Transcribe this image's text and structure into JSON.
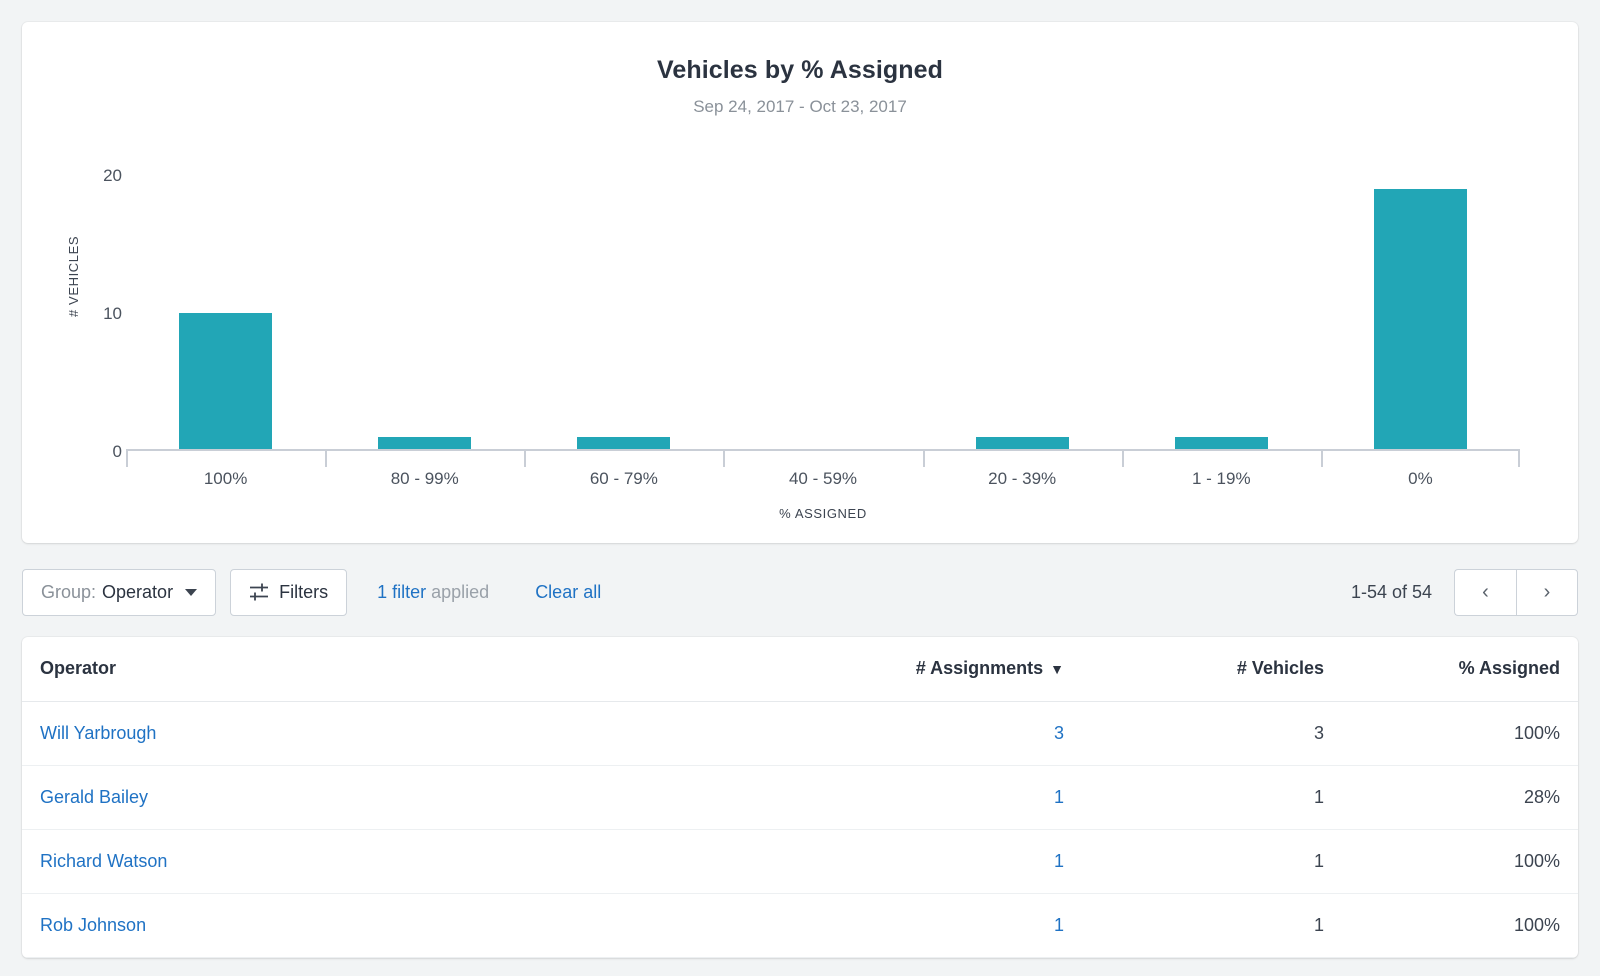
{
  "chart_card": {
    "title": "Vehicles by % Assigned",
    "subtitle": "Sep 24, 2017 - Oct 23, 2017"
  },
  "chart_data": {
    "type": "bar",
    "title": "Vehicles by % Assigned",
    "subtitle": "Sep 24, 2017 - Oct 23, 2017",
    "xlabel": "% ASSIGNED",
    "ylabel": "# VEHICLES",
    "categories": [
      "100%",
      "80 - 99%",
      "60 - 79%",
      "40 - 59%",
      "20 - 39%",
      "1 - 19%",
      "0%"
    ],
    "values": [
      10,
      1,
      1,
      0,
      1,
      1,
      19
    ],
    "yticks": [
      0,
      10,
      20
    ],
    "ylim": [
      0,
      20
    ],
    "grid": false,
    "legend": false,
    "bar_color": "#22a6b6"
  },
  "toolbar": {
    "group_prefix": "Group:",
    "group_value": "Operator",
    "filters_label": "Filters",
    "filter_applied_count": "1 filter",
    "filter_applied_suffix": "applied",
    "clear_all_label": "Clear all",
    "range_text": "1-54 of 54",
    "prev_label": "‹",
    "next_label": "›"
  },
  "table": {
    "columns": {
      "operator": "Operator",
      "assignments": "# Assignments",
      "assignments_sort": "▼",
      "vehicles": "# Vehicles",
      "percent_assigned": "% Assigned"
    },
    "rows": [
      {
        "operator": "Will Yarbrough",
        "assignments": "3",
        "vehicles": "3",
        "percent_assigned": "100%"
      },
      {
        "operator": "Gerald Bailey",
        "assignments": "1",
        "vehicles": "1",
        "percent_assigned": "28%"
      },
      {
        "operator": "Richard Watson",
        "assignments": "1",
        "vehicles": "1",
        "percent_assigned": "100%"
      },
      {
        "operator": "Rob Johnson",
        "assignments": "1",
        "vehicles": "1",
        "percent_assigned": "100%"
      }
    ]
  },
  "colors": {
    "accent_teal": "#22a6b6",
    "link_blue": "#1f72c4",
    "page_bg": "#f2f4f5"
  }
}
